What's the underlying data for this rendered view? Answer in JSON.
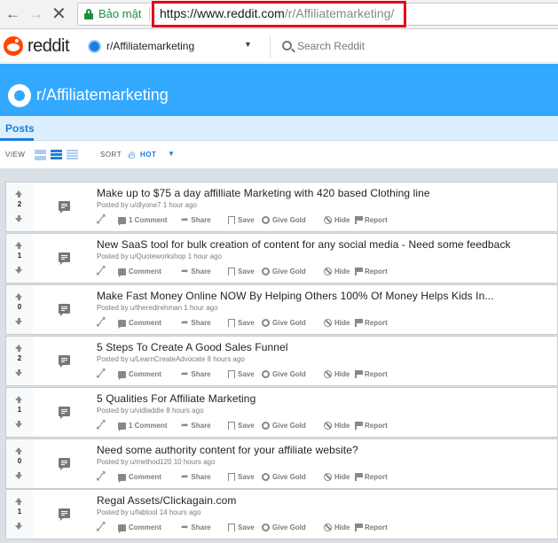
{
  "browser": {
    "secure_label": "Bảo mật",
    "url_main": "https://www.reddit.com",
    "url_path": "/r/Affiliatemarketing/"
  },
  "header": {
    "logo_text": "reddit",
    "subreddit": "r/Affiliatemarketing",
    "search_placeholder": "Search Reddit"
  },
  "banner": {
    "title": "r/Affiliatemarketing"
  },
  "tabs": {
    "posts": "Posts"
  },
  "viewbar": {
    "view_label": "VIEW",
    "sort_label": "SORT",
    "sort_value": "HOT"
  },
  "colors": {
    "accent": "#1b7de0",
    "banner": "#33a8ff",
    "reddit_orange": "#ff4500",
    "url_highlight": "#e2001a"
  },
  "posts": [
    {
      "score": "2",
      "title": "Make up to $75 a day affilliate Marketing with 420 based Clothing line",
      "meta": "Posted by u/dlyone7 1 hour ago",
      "comments": "1 Comment"
    },
    {
      "score": "1",
      "title": "New SaaS tool for bulk creation of content for any social media - Need some feedback",
      "meta": "Posted by u/Quoteworkshop 1 hour ago",
      "comments": "Comment"
    },
    {
      "score": "0",
      "title": "Make Fast Money Online NOW By Helping Others 100% Of Money Helps Kids In...",
      "meta": "Posted by u/theredirehman 1 hour ago",
      "comments": "Comment"
    },
    {
      "score": "2",
      "title": "5 Steps To Create A Good Sales Funnel",
      "meta": "Posted by u/LearnCreateAdvocate 8 hours ago",
      "comments": "Comment"
    },
    {
      "score": "1",
      "title": "5 Qualities For Affiliate Marketing",
      "meta": "Posted by u/vidladdie 8 hours ago",
      "comments": "1 Comment"
    },
    {
      "score": "0",
      "title": "Need some authority content for your affiliate website?",
      "meta": "Posted by u/method120 10 hours ago",
      "comments": "Comment"
    },
    {
      "score": "1",
      "title": "Regal Assets/Clickagain.com",
      "meta": "Posted by u/fabtool 14 hours ago",
      "comments": "Comment"
    }
  ],
  "actions": {
    "share": "Share",
    "save": "Save",
    "give_gold": "Give Gold",
    "hide": "Hide",
    "report": "Report"
  }
}
